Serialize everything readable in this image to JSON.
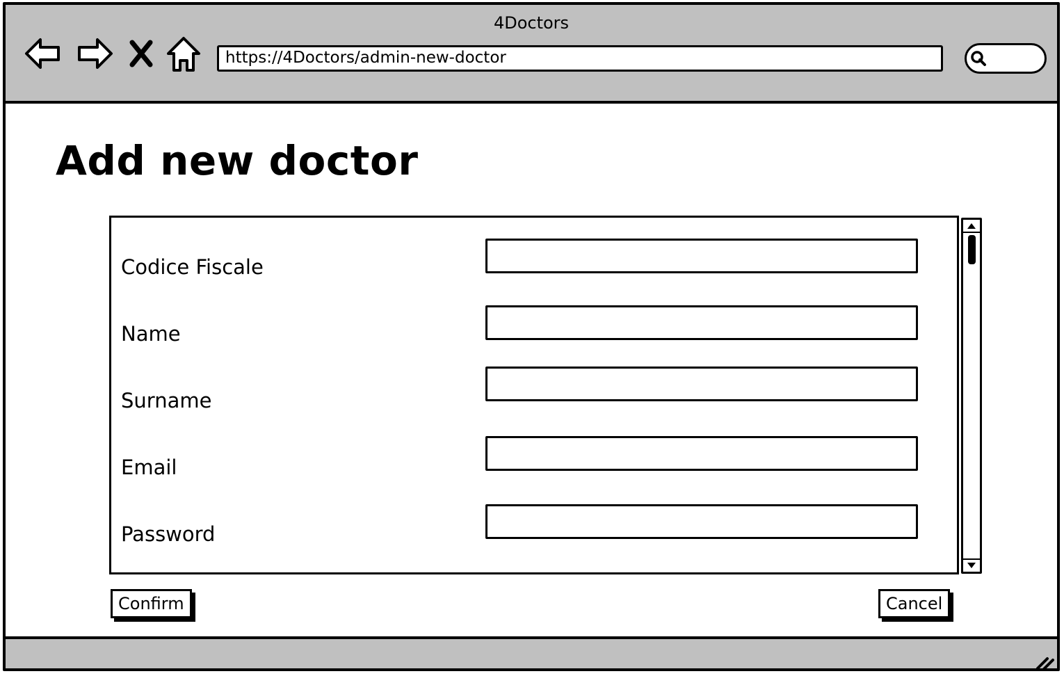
{
  "window": {
    "title": "4Doctors"
  },
  "browser": {
    "url": "https://4Doctors/admin-new-doctor",
    "icons": [
      "back-arrow-icon",
      "forward-arrow-icon",
      "stop-icon",
      "home-icon",
      "search-icon"
    ]
  },
  "page": {
    "title": "Add new doctor"
  },
  "form": {
    "fields": [
      {
        "label": "Codice Fiscale",
        "value": ""
      },
      {
        "label": "Name",
        "value": ""
      },
      {
        "label": "Surname",
        "value": ""
      },
      {
        "label": "Email",
        "value": ""
      },
      {
        "label": "Password",
        "value": ""
      }
    ]
  },
  "actions": {
    "confirm_label": "Confirm",
    "cancel_label": "Cancel"
  },
  "colors": {
    "chrome_gray": "#c0c0c0",
    "ink": "#000000",
    "paper": "#ffffff"
  }
}
